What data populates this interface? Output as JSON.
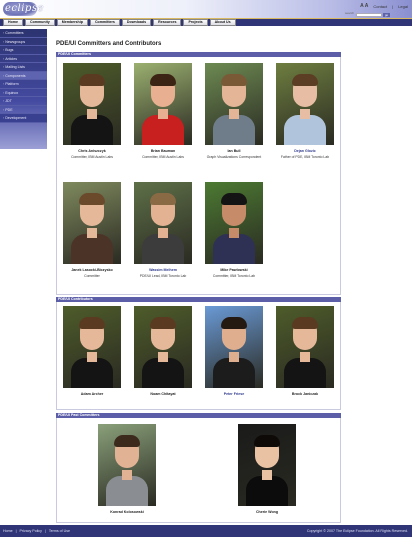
{
  "header": {
    "logo": "eclipse",
    "font_size_label": "A A",
    "links": [
      "Contact",
      "Legal"
    ],
    "search_label": "search",
    "search_button": "go"
  },
  "nav": {
    "tabs": [
      "Home",
      "Community",
      "Membership",
      "Committers",
      "Downloads",
      "Resources",
      "Projects",
      "About Us"
    ]
  },
  "sidebar": {
    "items": [
      {
        "label": "Committers",
        "type": "normal"
      },
      {
        "label": "Newsgroups",
        "type": "normal"
      },
      {
        "label": "Bugs",
        "type": "normal"
      },
      {
        "label": "Articles",
        "type": "normal"
      },
      {
        "label": "Mailing Lists",
        "type": "normal"
      },
      {
        "label": "Components",
        "type": "sub"
      },
      {
        "label": "Platform",
        "type": "normal"
      },
      {
        "label": "Equinox",
        "type": "normal"
      },
      {
        "label": "JDT",
        "type": "normal"
      },
      {
        "label": "PDE",
        "type": "normal"
      },
      {
        "label": "Development",
        "type": "dev"
      }
    ]
  },
  "page_title": "PDE/UI Committers and Contributors",
  "sections": {
    "committers": {
      "title": "PDE/UI Committers",
      "people": [
        {
          "name": "Chris Aniszczyk",
          "role": "Committer, IBM Austin Labs",
          "link": false
        },
        {
          "name": "Brian Bauman",
          "role": "Committer, IBM Austin Labs",
          "link": false
        },
        {
          "name": "Ian Bull",
          "role": "Graph Visualizations Correspondent",
          "link": false
        },
        {
          "name": "Dejan Glozic",
          "role": "Father of PDE, IBM Toronto Lab",
          "link": true
        },
        {
          "name": "Janek Lasocki-Biczysko",
          "role": "Committer",
          "link": false
        },
        {
          "name": "Wassim Melhem",
          "role": "PDE/UI Lead, IBM Toronto Lab",
          "link": true
        },
        {
          "name": "Mike Pawlowski",
          "role": "Committer, IBM Toronto Lab",
          "link": false
        }
      ]
    },
    "contributors": {
      "title": "PDE/UI Contributors",
      "people": [
        {
          "name": "Adam Archer",
          "link": false
        },
        {
          "name": "Noam Chitayat",
          "link": false
        },
        {
          "name": "Peter Friese",
          "link": true
        },
        {
          "name": "Brock Janiczak",
          "link": false
        }
      ]
    },
    "past": {
      "title": "PDE/UI Past Committers",
      "people": [
        {
          "name": "Konrad Kolosowski",
          "link": false
        },
        {
          "name": "Cherie Wong",
          "link": false
        }
      ]
    }
  },
  "footer": {
    "links": [
      "Home",
      "Privacy Policy",
      "Terms of Use"
    ],
    "copyright": "Copyright © 2007 The Eclipse Foundation. All Rights Reserved."
  },
  "colors": {
    "nav_bg": "#2f3576",
    "section_bar": "#5c5ea8",
    "link": "#2e3a8c"
  }
}
